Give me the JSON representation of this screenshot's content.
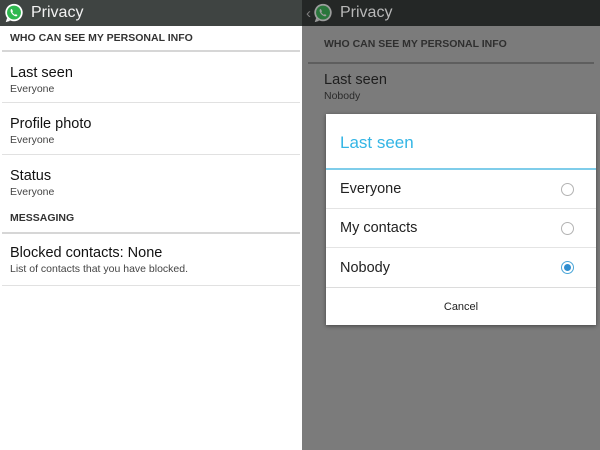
{
  "colors": {
    "actionbar": "#3f4442",
    "accent": "#33b5e5",
    "radio_checked": "#2f8ed0"
  },
  "left": {
    "app_icon": "whatsapp-logo-icon",
    "title": "Privacy",
    "sections": [
      {
        "header": "WHO CAN SEE MY PERSONAL INFO",
        "items": [
          {
            "title": "Last seen",
            "sub": "Everyone"
          },
          {
            "title": "Profile photo",
            "sub": "Everyone"
          },
          {
            "title": "Status",
            "sub": "Everyone"
          }
        ]
      },
      {
        "header": "MESSAGING",
        "items": [
          {
            "title": "Blocked contacts: None",
            "sub": "List of contacts that you have blocked."
          }
        ]
      }
    ]
  },
  "right": {
    "title": "Privacy",
    "back_icon": "chevron-left-icon",
    "section_header": "WHO CAN SEE MY PERSONAL INFO",
    "item": {
      "title": "Last seen",
      "sub": "Nobody"
    },
    "dialog": {
      "title": "Last seen",
      "options": [
        {
          "label": "Everyone",
          "selected": false
        },
        {
          "label": "My contacts",
          "selected": false
        },
        {
          "label": "Nobody",
          "selected": true
        }
      ],
      "cancel_label": "Cancel"
    }
  }
}
